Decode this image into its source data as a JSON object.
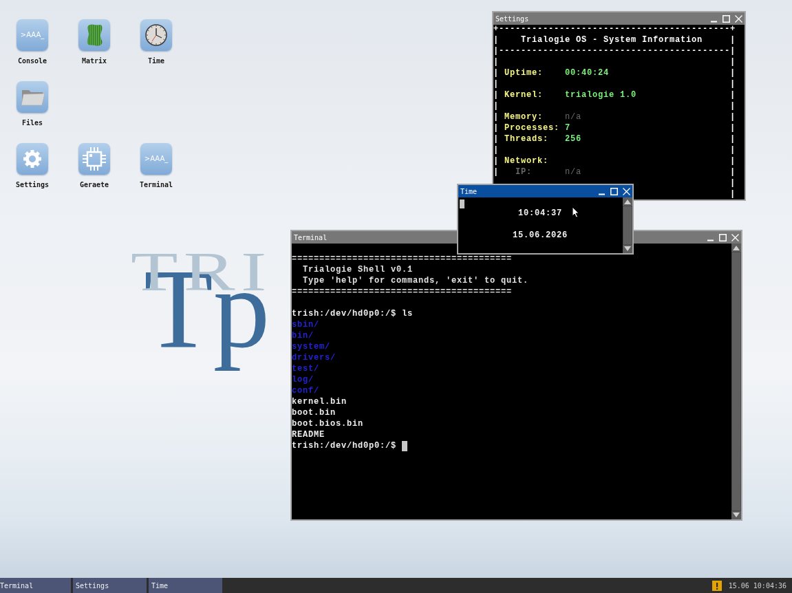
{
  "desktop": {
    "wallpaper_text": {
      "faint": "TRI",
      "main": "Tp"
    },
    "icon_rows": [
      [
        {
          "label": "Console",
          "kind": "prompt",
          "icon_text": ">AAA_"
        },
        {
          "label": "Matrix",
          "kind": "matrix"
        },
        {
          "label": "Time",
          "kind": "clock"
        }
      ],
      [
        {
          "label": "Files",
          "kind": "folder"
        }
      ],
      [
        {
          "label": "Settings",
          "kind": "gear"
        },
        {
          "label": "Geraete",
          "kind": "chip"
        },
        {
          "label": "Terminal",
          "kind": "prompt",
          "icon_text": ">AAA_"
        }
      ]
    ]
  },
  "settings_window": {
    "title": "Settings",
    "active": false,
    "lines": [
      {
        "kind": "rule",
        "text": "+------------------------------------------+"
      },
      {
        "kind": "heading",
        "left": "|",
        "text": "Trialogie OS - System Information",
        "right": "|"
      },
      {
        "kind": "rule",
        "text": "|------------------------------------------|"
      },
      {
        "kind": "blank",
        "left": "|",
        "right": "|"
      },
      {
        "kind": "field",
        "left": "|",
        "label": "Uptime:",
        "value": "00:40:24",
        "available": true,
        "right": "|"
      },
      {
        "kind": "blank",
        "left": "|",
        "right": "|"
      },
      {
        "kind": "field",
        "left": "|",
        "label": "Kernel:",
        "value": "trialogie 1.0",
        "available": true,
        "right": "|"
      },
      {
        "kind": "blank",
        "left": "|",
        "right": "|"
      },
      {
        "kind": "field",
        "left": "|",
        "label": "Memory:",
        "value": "n/a",
        "available": false,
        "right": "|"
      },
      {
        "kind": "field",
        "left": "|",
        "label": "Processes:",
        "value": "7",
        "available": true,
        "right": "|"
      },
      {
        "kind": "field",
        "left": "|",
        "label": "Threads:",
        "value": "256",
        "available": true,
        "right": "|"
      },
      {
        "kind": "blank",
        "left": "|",
        "right": "|"
      },
      {
        "kind": "section",
        "left": "|",
        "label": "Network:",
        "right": "|"
      },
      {
        "kind": "subfield",
        "left": "|",
        "label": "IP:",
        "value": "n/a",
        "available": false,
        "right": "|"
      },
      {
        "kind": "blank",
        "right": "|"
      },
      {
        "kind": "blank",
        "right": "|"
      }
    ]
  },
  "time_window": {
    "title": "Time",
    "active": true,
    "cursor": true,
    "time": "10:04:37",
    "date": "15.06.2026"
  },
  "terminal_window": {
    "title": "Terminal",
    "active": false,
    "lines": [
      {
        "kind": "rule",
        "text": "========================================"
      },
      {
        "kind": "info",
        "text": "Trialogie Shell v0.1"
      },
      {
        "kind": "info",
        "text": "Type 'help' for commands, 'exit' to quit."
      },
      {
        "kind": "rule",
        "text": "========================================"
      },
      {
        "kind": "blank"
      },
      {
        "kind": "prompt",
        "prompt": "trish:/dev/hd0p0:/$",
        "command": "ls",
        "cursor": false
      },
      {
        "kind": "dir",
        "text": "sbin/"
      },
      {
        "kind": "dir",
        "text": "bin/"
      },
      {
        "kind": "dir",
        "text": "system/"
      },
      {
        "kind": "dir",
        "text": "drivers/"
      },
      {
        "kind": "dir",
        "text": "test/"
      },
      {
        "kind": "dir",
        "text": "log/"
      },
      {
        "kind": "dir",
        "text": "conf/"
      },
      {
        "kind": "file",
        "text": "kernel.bin"
      },
      {
        "kind": "file",
        "text": "boot.bin"
      },
      {
        "kind": "file",
        "text": "boot.bios.bin"
      },
      {
        "kind": "file",
        "text": "README"
      },
      {
        "kind": "prompt",
        "prompt": "trish:/dev/hd0p0:/$",
        "cursor": true
      }
    ]
  },
  "taskbar": {
    "items": [
      {
        "label": "Terminal"
      },
      {
        "label": "Settings"
      },
      {
        "label": "Time"
      }
    ],
    "warning": true,
    "clock": "15.06 10:04:36"
  }
}
